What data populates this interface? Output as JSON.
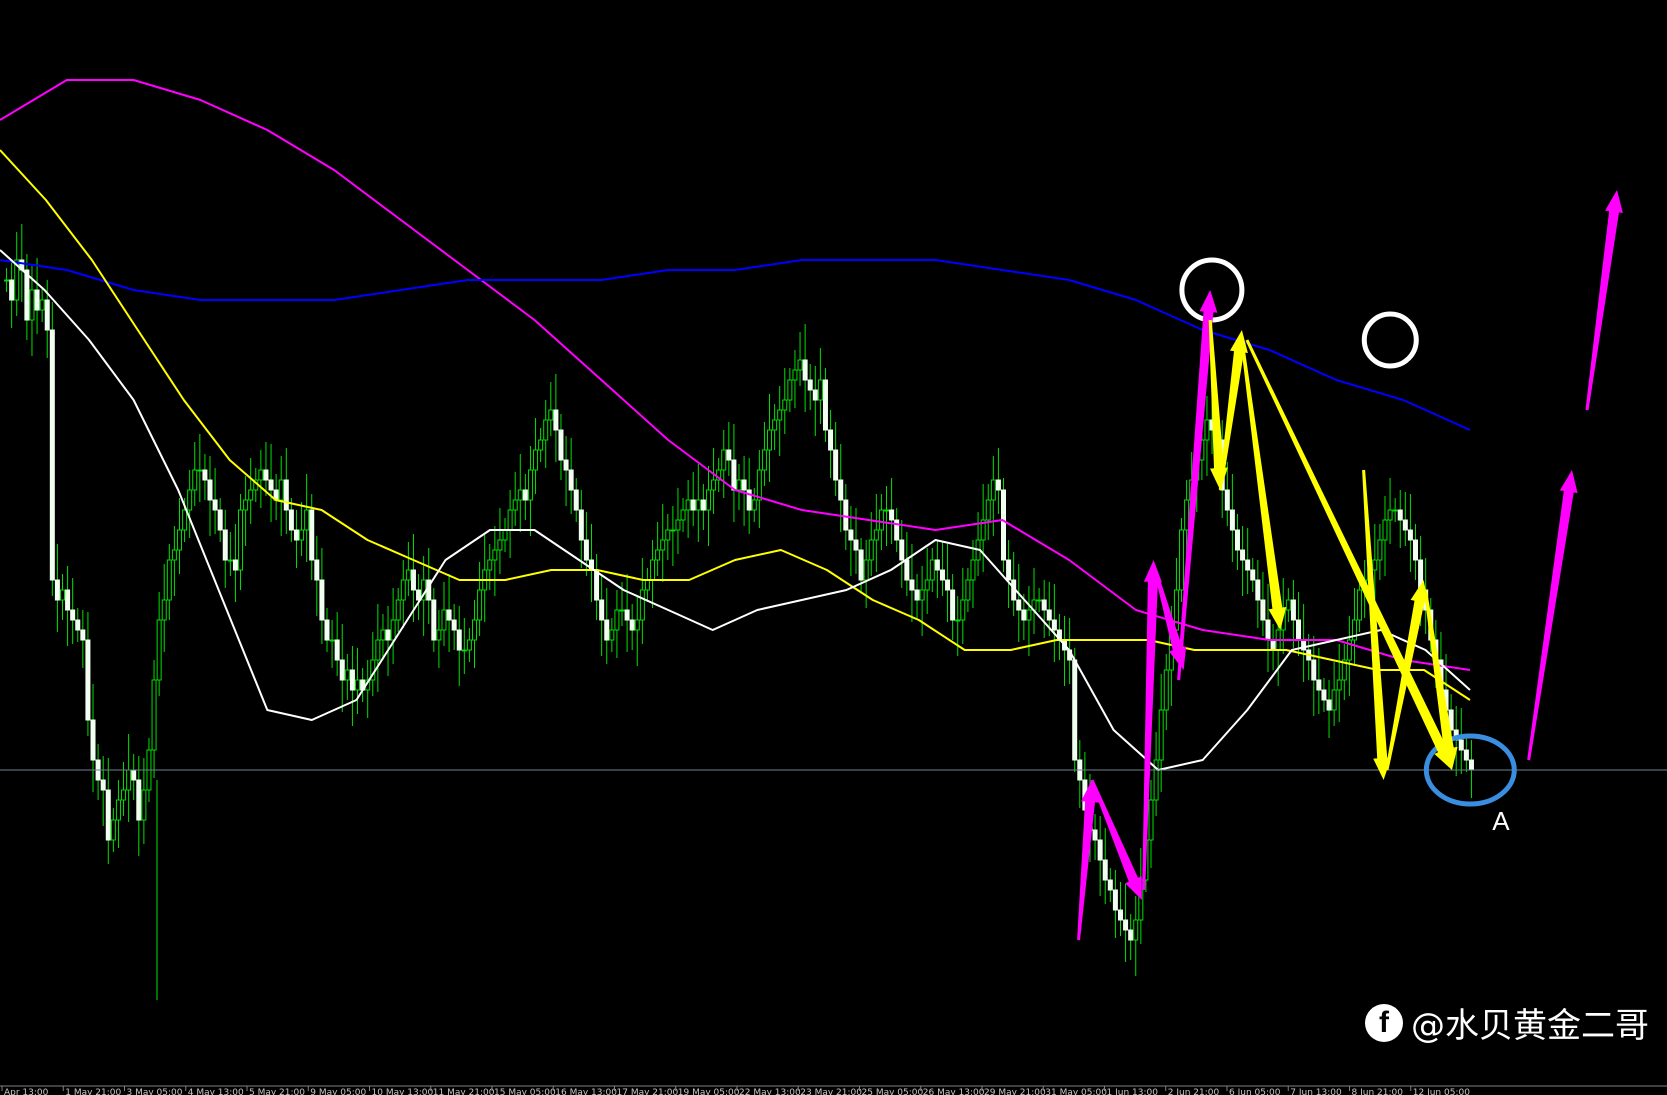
{
  "chart_data": {
    "type": "candlestick",
    "title": "",
    "xlabel": "",
    "ylabel": "",
    "grid": false,
    "x_ticks": [
      "Apr 13:00",
      "1 May 21:00",
      "3 May 05:00",
      "4 May 13:00",
      "5 May 21:00",
      "9 May 05:00",
      "10 May 13:00",
      "11 May 21:00",
      "15 May 05:00",
      "16 May 13:00",
      "17 May 21:00",
      "19 May 05:00",
      "22 May 13:00",
      "23 May 21:00",
      "25 May 05:00",
      "26 May 13:00",
      "29 May 21:00",
      "31 May 05:00",
      "1 Jun 13:00",
      "2 Jun 21:00",
      "6 Jun 05:00",
      "7 Jun 13:00",
      "8 Jun 21:00",
      "12 Jun 05:00"
    ],
    "candles_close": [
      0.78,
      0.76,
      0.8,
      0.79,
      0.74,
      0.77,
      0.75,
      0.76,
      0.73,
      0.48,
      0.46,
      0.47,
      0.45,
      0.44,
      0.43,
      0.42,
      0.34,
      0.3,
      0.28,
      0.27,
      0.22,
      0.24,
      0.26,
      0.27,
      0.29,
      0.28,
      0.24,
      0.27,
      0.31,
      0.38,
      0.44,
      0.46,
      0.5,
      0.51,
      0.53,
      0.55,
      0.57,
      0.59,
      0.59,
      0.58,
      0.56,
      0.55,
      0.53,
      0.5,
      0.5,
      0.49,
      0.55,
      0.56,
      0.57,
      0.58,
      0.59,
      0.58,
      0.57,
      0.56,
      0.58,
      0.55,
      0.53,
      0.52,
      0.53,
      0.55,
      0.5,
      0.48,
      0.44,
      0.42,
      0.42,
      0.4,
      0.38,
      0.39,
      0.37,
      0.38,
      0.37,
      0.38,
      0.4,
      0.42,
      0.43,
      0.42,
      0.44,
      0.46,
      0.48,
      0.49,
      0.47,
      0.46,
      0.48,
      0.46,
      0.42,
      0.43,
      0.45,
      0.44,
      0.43,
      0.41,
      0.41,
      0.42,
      0.44,
      0.47,
      0.49,
      0.5,
      0.51,
      0.52,
      0.53,
      0.55,
      0.56,
      0.57,
      0.56,
      0.59,
      0.61,
      0.62,
      0.64,
      0.65,
      0.63,
      0.6,
      0.59,
      0.57,
      0.55,
      0.52,
      0.5,
      0.49,
      0.46,
      0.44,
      0.42,
      0.43,
      0.45,
      0.45,
      0.44,
      0.43,
      0.44,
      0.47,
      0.48,
      0.5,
      0.51,
      0.52,
      0.53,
      0.53,
      0.54,
      0.55,
      0.56,
      0.55,
      0.56,
      0.55,
      0.57,
      0.58,
      0.59,
      0.61,
      0.6,
      0.57,
      0.58,
      0.57,
      0.55,
      0.56,
      0.59,
      0.61,
      0.63,
      0.64,
      0.65,
      0.66,
      0.68,
      0.69,
      0.7,
      0.68,
      0.67,
      0.66,
      0.68,
      0.63,
      0.61,
      0.58,
      0.56,
      0.53,
      0.52,
      0.51,
      0.48,
      0.5,
      0.52,
      0.53,
      0.55,
      0.55,
      0.54,
      0.52,
      0.5,
      0.48,
      0.47,
      0.46,
      0.47,
      0.48,
      0.5,
      0.49,
      0.48,
      0.47,
      0.44,
      0.44,
      0.46,
      0.48,
      0.5,
      0.52,
      0.54,
      0.56,
      0.58,
      0.57,
      0.5,
      0.48,
      0.46,
      0.45,
      0.44,
      0.45,
      0.46,
      0.46,
      0.45,
      0.44,
      0.43,
      0.42,
      0.41,
      0.4,
      0.3,
      0.28,
      0.25,
      0.23,
      0.22,
      0.2,
      0.18,
      0.17,
      0.15,
      0.14,
      0.13,
      0.12,
      0.14,
      0.18,
      0.22,
      0.26,
      0.3,
      0.35,
      0.39,
      0.43,
      0.47,
      0.53,
      0.56,
      0.58,
      0.6,
      0.62,
      0.64,
      0.63,
      0.62,
      0.57,
      0.55,
      0.53,
      0.51,
      0.5,
      0.49,
      0.48,
      0.46,
      0.44,
      0.42,
      0.41,
      0.43,
      0.45,
      0.46,
      0.44,
      0.42,
      0.41,
      0.4,
      0.38,
      0.37,
      0.36,
      0.35,
      0.37,
      0.38,
      0.4,
      0.42,
      0.44,
      0.47,
      0.48,
      0.49,
      0.5,
      0.52,
      0.54,
      0.55,
      0.55,
      0.54,
      0.53,
      0.52,
      0.5,
      0.47,
      0.45,
      0.42,
      0.4,
      0.37,
      0.35,
      0.33,
      0.32,
      0.31,
      0.3,
      0.29
    ],
    "series": [
      {
        "color": "#ff00ff",
        "values": [
          0.94,
          0.98,
          0.98,
          0.96,
          0.93,
          0.89,
          0.84,
          0.79,
          0.74,
          0.68,
          0.62,
          0.57,
          0.55,
          0.54,
          0.53,
          0.54,
          0.5,
          0.45,
          0.43,
          0.42,
          0.42,
          0.4,
          0.39
        ]
      },
      {
        "color": "#0000ff",
        "values": [
          0.8,
          0.79,
          0.77,
          0.76,
          0.76,
          0.76,
          0.77,
          0.78,
          0.78,
          0.78,
          0.79,
          0.79,
          0.8,
          0.8,
          0.8,
          0.79,
          0.78,
          0.76,
          0.73,
          0.71,
          0.68,
          0.66,
          0.63
        ]
      },
      {
        "color": "#ffff00",
        "values": [
          0.91,
          0.86,
          0.8,
          0.73,
          0.66,
          0.6,
          0.56,
          0.55,
          0.52,
          0.5,
          0.48,
          0.48,
          0.49,
          0.49,
          0.48,
          0.48,
          0.5,
          0.51,
          0.49,
          0.46,
          0.44,
          0.41,
          0.41,
          0.42,
          0.42,
          0.42,
          0.41,
          0.41,
          0.41,
          0.4,
          0.39,
          0.39,
          0.36
        ]
      },
      {
        "color": "#ffffff",
        "values": [
          0.81,
          0.77,
          0.72,
          0.66,
          0.57,
          0.46,
          0.35,
          0.34,
          0.36,
          0.43,
          0.5,
          0.53,
          0.53,
          0.5,
          0.47,
          0.45,
          0.43,
          0.45,
          0.46,
          0.47,
          0.49,
          0.52,
          0.51,
          0.46,
          0.41,
          0.33,
          0.29,
          0.3,
          0.35,
          0.41,
          0.42,
          0.43,
          0.41,
          0.37
        ]
      }
    ],
    "hline": {
      "value": 0.29,
      "color": "#708090"
    },
    "annotations": {
      "label": "A",
      "circles": [
        {
          "x": 0.727,
          "y": 0.77,
          "color": "#ffffff"
        },
        {
          "x": 0.834,
          "y": 0.72,
          "color": "#ffffff"
        },
        {
          "x": 0.882,
          "y": 0.29,
          "color": "#3a8ee0"
        }
      ],
      "arrows": [
        {
          "color": "#ff00ff",
          "pts": [
            [
              0.647,
              0.12
            ],
            [
              0.655,
              0.28
            ]
          ]
        },
        {
          "color": "#ff00ff",
          "pts": [
            [
              0.655,
              0.28
            ],
            [
              0.685,
              0.16
            ]
          ]
        },
        {
          "color": "#ff00ff",
          "pts": [
            [
              0.686,
              0.17
            ],
            [
              0.692,
              0.5
            ]
          ]
        },
        {
          "color": "#ff00ff",
          "pts": [
            [
              0.693,
              0.49
            ],
            [
              0.71,
              0.39
            ]
          ]
        },
        {
          "color": "#ff00ff",
          "pts": [
            [
              0.707,
              0.38
            ],
            [
              0.726,
              0.77
            ]
          ]
        },
        {
          "color": "#ffff00",
          "pts": [
            [
              0.726,
              0.74
            ],
            [
              0.732,
              0.57
            ]
          ]
        },
        {
          "color": "#ffff00",
          "pts": [
            [
              0.732,
              0.57
            ],
            [
              0.745,
              0.73
            ]
          ]
        },
        {
          "color": "#ffff00",
          "pts": [
            [
              0.745,
              0.72
            ],
            [
              0.768,
              0.43
            ]
          ]
        },
        {
          "color": "#ffff00",
          "pts": [
            [
              0.748,
              0.72
            ],
            [
              0.871,
              0.29
            ]
          ]
        },
        {
          "color": "#ffff00",
          "pts": [
            [
              0.818,
              0.59
            ],
            [
              0.83,
              0.28
            ]
          ]
        },
        {
          "color": "#ffff00",
          "pts": [
            [
              0.832,
              0.29
            ],
            [
              0.854,
              0.48
            ]
          ]
        },
        {
          "color": "#ffff00",
          "pts": [
            [
              0.855,
              0.47
            ],
            [
              0.871,
              0.29
            ]
          ]
        },
        {
          "color": "#ff00ff",
          "pts": [
            [
              0.917,
              0.3
            ],
            [
              0.943,
              0.59
            ]
          ]
        },
        {
          "color": "#ff00ff",
          "pts": [
            [
              0.952,
              0.65
            ],
            [
              0.97,
              0.87
            ]
          ]
        }
      ]
    }
  },
  "watermark": {
    "handle": "@水贝黄金二哥",
    "logo": "f"
  }
}
